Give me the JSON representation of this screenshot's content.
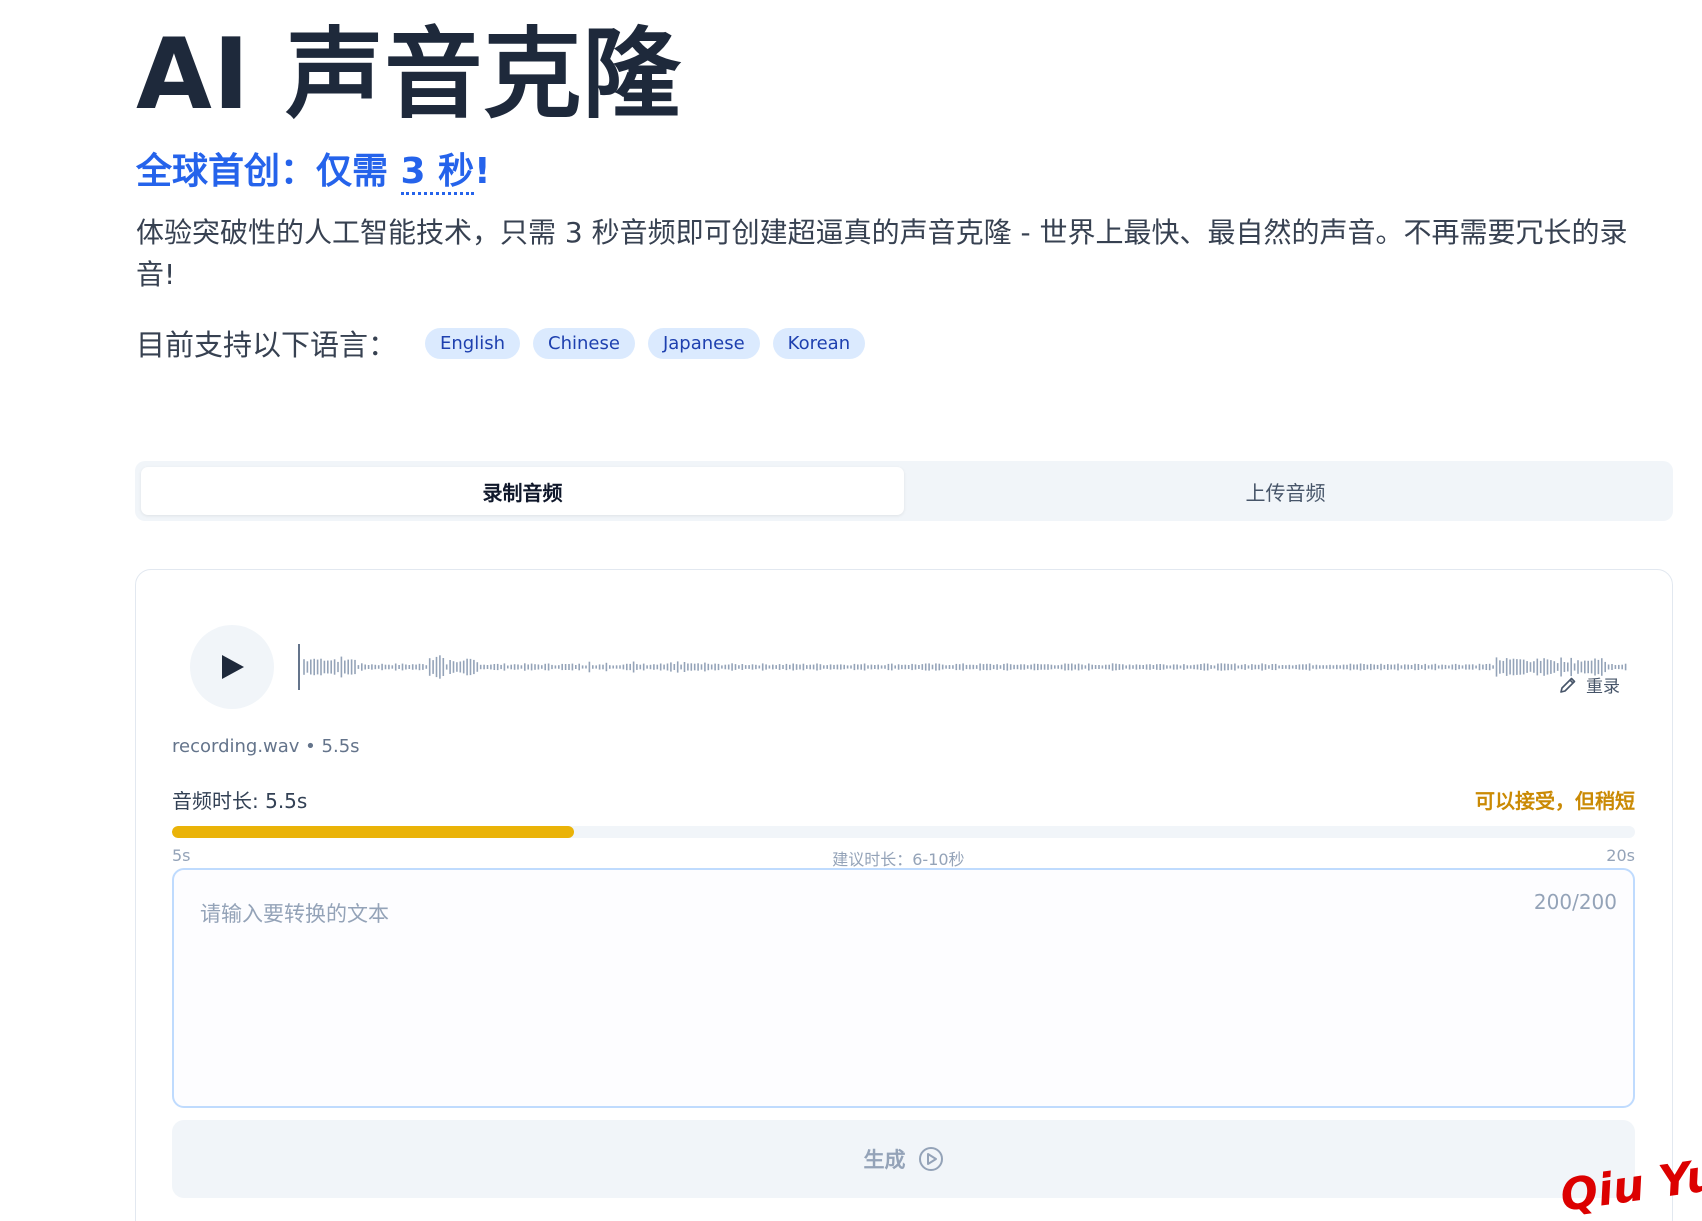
{
  "header": {
    "title": "AI 声音克隆",
    "subtitle_prefix": "全球首创：仅需 ",
    "subtitle_highlight": "3 秒",
    "subtitle_suffix": "!",
    "description": "体验突破性的人工智能技术，只需 3 秒音频即可创建超逼真的声音克隆 - 世界上最快、最自然的声音。不再需要冗长的录音!"
  },
  "languages": {
    "label": "目前支持以下语言：",
    "items": [
      "English",
      "Chinese",
      "Japanese",
      "Korean"
    ]
  },
  "tabs": [
    {
      "label": "录制音频",
      "active": true
    },
    {
      "label": "上传音频",
      "active": false
    }
  ],
  "player": {
    "play_icon": "play-icon",
    "rerecord_label": "重录",
    "rerecord_icon": "pencil-icon",
    "file_info": "recording.wav • 5.5s"
  },
  "duration": {
    "label": "音频时长: 5.5s",
    "status": "可以接受，但稍短",
    "progress_fraction": 0.275,
    "scale_min": "5s",
    "scale_hint": "建议时长：6-10秒",
    "scale_max": "20s"
  },
  "text_input": {
    "placeholder": "请输入要转换的文本",
    "counter": "200/200"
  },
  "generate": {
    "label": "生成",
    "icon": "play-circle-icon"
  },
  "watermark": "Qiu Yue",
  "colors": {
    "accent": "#2563eb",
    "warning": "#ca8a04",
    "progress": "#eab308",
    "chip_bg": "#dbeafe"
  }
}
